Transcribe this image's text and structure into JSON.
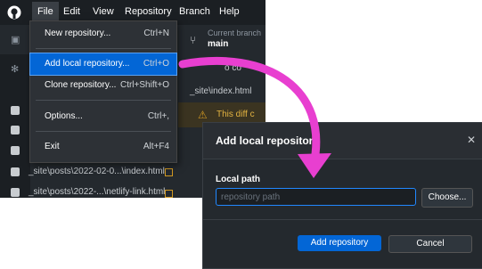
{
  "menubar": {
    "items": [
      "File",
      "Edit",
      "View",
      "Repository",
      "Branch",
      "Help"
    ]
  },
  "branch": {
    "caption": "Current branch",
    "name": "main"
  },
  "background": {
    "path_top": "_site\\index.html",
    "fragment_to": "o co",
    "warning": "This diff c",
    "rows": [
      "_site\\posts\\2022-02-0...\\index.html",
      "_site\\posts\\2022-...\\netlify-link.html"
    ]
  },
  "file_menu": {
    "items": [
      {
        "label": "New repository...",
        "accel": "Ctrl+N"
      },
      {
        "label": "Add local repository...",
        "accel": "Ctrl+O"
      },
      {
        "label": "Clone repository...",
        "accel": "Ctrl+Shift+O"
      },
      {
        "label": "Options...",
        "accel": "Ctrl+,"
      },
      {
        "label": "Exit",
        "accel": "Alt+F4"
      }
    ]
  },
  "dialog": {
    "title": "Add local repository",
    "local_path_label": "Local path",
    "path_placeholder": "repository path",
    "choose_label": "Choose...",
    "add_label": "Add repository",
    "cancel_label": "Cancel"
  },
  "colors": {
    "accent": "#0366d6",
    "arrow": "#e83fd0",
    "warning": "#d29922"
  }
}
